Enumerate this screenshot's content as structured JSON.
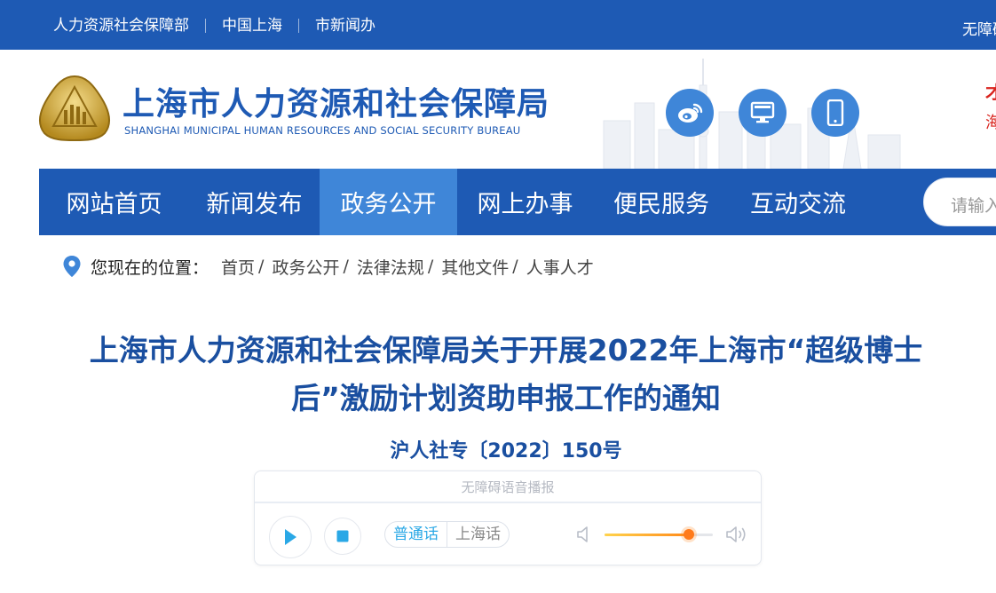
{
  "topbar": {
    "links": [
      "人力资源社会保障部",
      "中国上海",
      "市新闻办"
    ],
    "accessibility": "无障碍"
  },
  "header": {
    "title": "上海市人力资源和社会保障局",
    "subtitle": "SHANGHAI MUNICIPAL HUMAN RESOURCES AND SOCIAL SECURITY BUREAU",
    "icons": [
      "weibo-icon",
      "desktop-icon",
      "mobile-icon"
    ],
    "edge_text_1": "才",
    "edge_text_2": "海"
  },
  "nav": {
    "items": [
      "网站首页",
      "新闻发布",
      "政务公开",
      "网上办事",
      "便民服务",
      "互动交流"
    ],
    "active_index": 2,
    "search_placeholder": "请输入"
  },
  "breadcrumb": {
    "label": "您现在的位置：",
    "items": [
      "首页",
      "政务公开",
      "法律法规",
      "其他文件",
      "人事人才"
    ]
  },
  "article": {
    "title": "上海市人力资源和社会保障局关于开展2022年上海市“超级博士后”激励计划资助申报工作的通知",
    "doc_number": "沪人社专〔2022〕150号"
  },
  "player": {
    "heading": "无障碍语音播报",
    "languages": [
      "普通话",
      "上海话"
    ],
    "selected_language": "普通话",
    "volume": 0.78
  },
  "colors": {
    "brand_blue": "#1e5ab4",
    "nav_active": "#3f86d8",
    "title_blue": "#1a4fa0",
    "accent_cyan": "#2aa8e6",
    "slider_orange": "#ff7a1a"
  }
}
